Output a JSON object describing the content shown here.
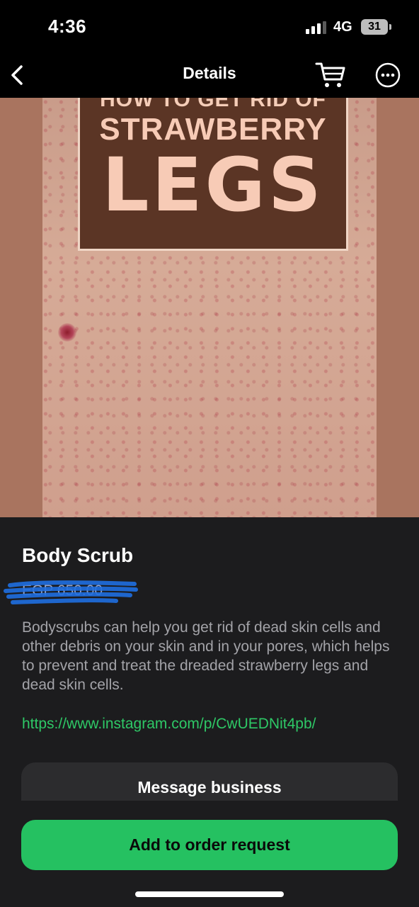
{
  "status_bar": {
    "time": "4:36",
    "network": "4G",
    "battery": "31"
  },
  "nav": {
    "title": "Details"
  },
  "hero_image": {
    "line1": "HOW TO GET RID OF",
    "line2": "STRAWBERRY",
    "line3": "LEGS"
  },
  "product": {
    "name": "Body Scrub",
    "price": "EGP 650.00",
    "description": "Bodyscrubs can help you get rid of dead skin cells and other debris on your skin and in your pores, which helps to prevent and treat the dreaded strawberry legs and dead skin cells.",
    "link": "https://www.instagram.com/p/CwUEDNit4pb/"
  },
  "actions": {
    "message_label": "Message business",
    "order_label": "Add to order request"
  },
  "colors": {
    "accent": "#25c161",
    "link": "#2ec866",
    "background": "#1c1c1e"
  }
}
